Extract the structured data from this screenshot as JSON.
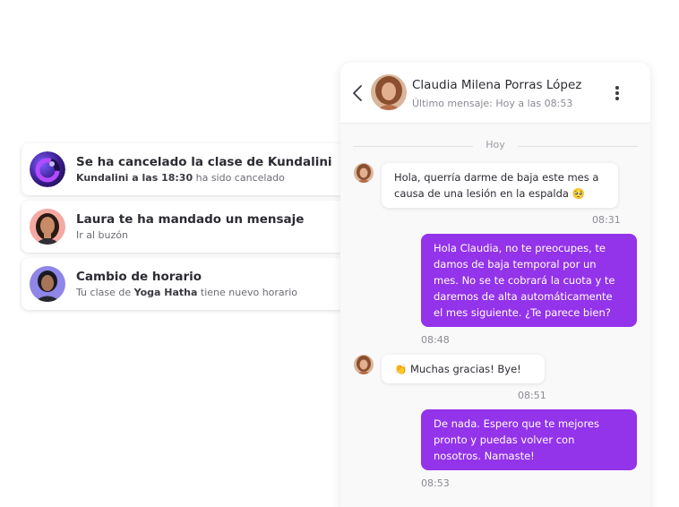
{
  "notifications": [
    {
      "icon": "kundalini-logo-icon",
      "title": "Se ha cancelado la clase de Kundalini",
      "sub_bold": "Kundalini a las 18:30",
      "sub_rest": " ha sido cancelado"
    },
    {
      "icon": "laura-avatar",
      "title": "Laura te ha mandado un mensaje",
      "sub": "Ir al buzón"
    },
    {
      "icon": "user-avatar",
      "title": "Cambio de horario",
      "sub_pre": "Tu clase de ",
      "sub_bold": "Yoga Hatha",
      "sub_post": " tiene nuevo horario"
    }
  ],
  "chat": {
    "contact_name": "Claudia Milena Porras López",
    "status": "Último mensaje: Hoy a las 08:53",
    "day_label": "Hoy",
    "accent": "#9333ea",
    "messages": [
      {
        "from": "contact",
        "text": "Hola, querría darme de baja este mes a causa de una lesión en la espalda 🥺",
        "time": "08:31"
      },
      {
        "from": "me",
        "text": "Hola Claudia, no te preocupes, te damos de baja temporal por un mes. No se te cobrará la cuota y te daremos de alta automáticamente el mes siguiente. ¿Te parece bien?",
        "time": "08:48"
      },
      {
        "from": "contact",
        "text": "👏 Muchas gracias! Bye!",
        "time": "08:51"
      },
      {
        "from": "me",
        "text": "De nada. Espero que te mejores pronto y puedas volver con nosotros. Namaste!",
        "time": "08:53"
      }
    ]
  }
}
